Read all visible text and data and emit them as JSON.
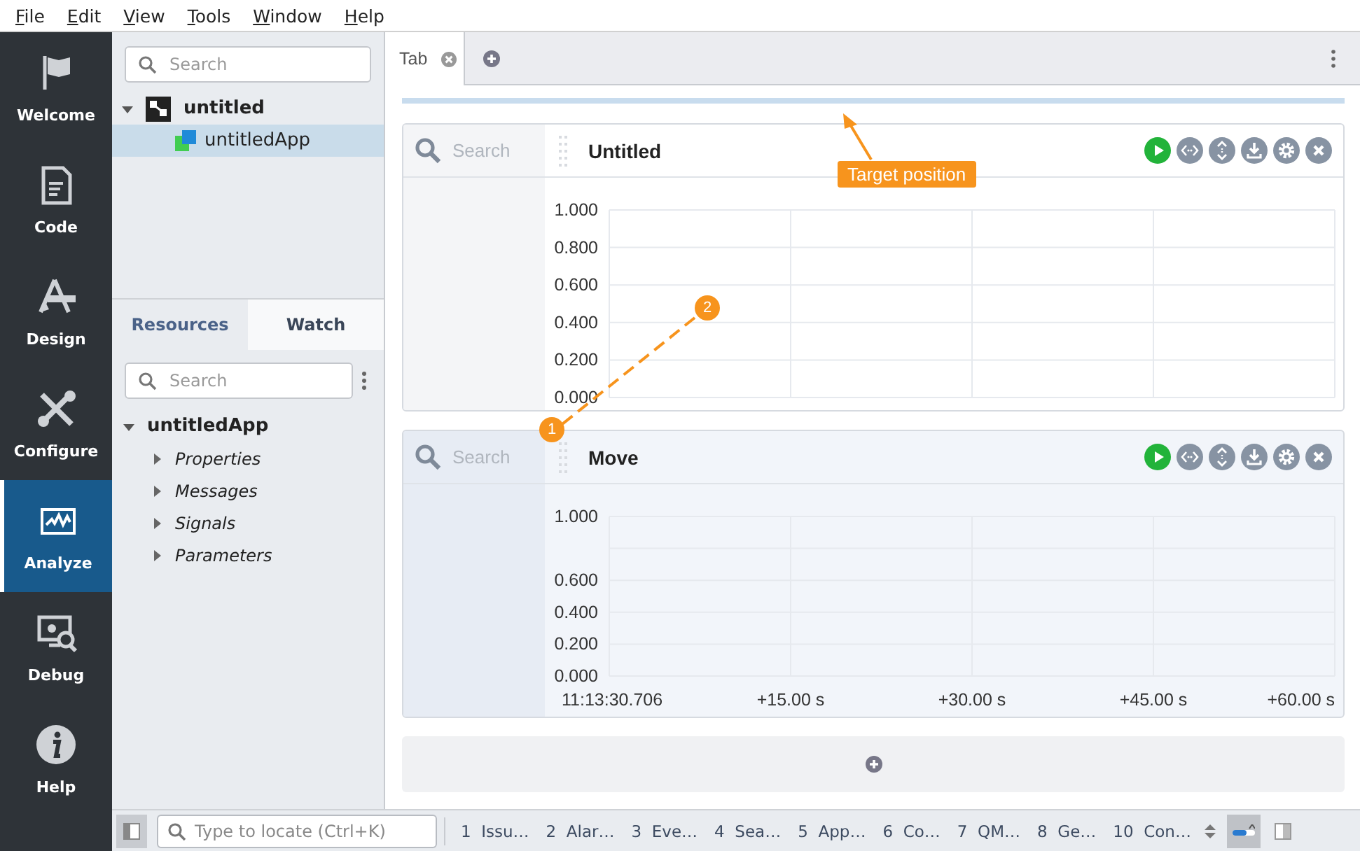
{
  "menu": [
    "File",
    "Edit",
    "View",
    "Tools",
    "Window",
    "Help"
  ],
  "modes": [
    {
      "label": "Welcome",
      "selected": false
    },
    {
      "label": "Code",
      "selected": false
    },
    {
      "label": "Design",
      "selected": false
    },
    {
      "label": "Configure",
      "selected": false
    },
    {
      "label": "Analyze",
      "selected": true
    },
    {
      "label": "Debug",
      "selected": false
    },
    {
      "label": "Help",
      "selected": false
    }
  ],
  "project_tree": {
    "search": {
      "placeholder": "Search"
    },
    "items": [
      {
        "label": "untitled",
        "expanded": true,
        "selected": false,
        "children": [
          {
            "label": "untitledApp",
            "selected": true
          }
        ]
      }
    ]
  },
  "resource_tabs": [
    {
      "label": "Resources",
      "selected": true
    },
    {
      "label": "Watch",
      "selected": false
    }
  ],
  "resource_search": {
    "placeholder": "Search"
  },
  "resource_tree": [
    {
      "label": "untitledApp",
      "expanded": true,
      "children": [
        {
          "label": "Properties",
          "expanded": false
        },
        {
          "label": "Messages",
          "expanded": false
        },
        {
          "label": "Signals",
          "expanded": false
        },
        {
          "label": "Parameters",
          "expanded": false
        }
      ]
    }
  ],
  "document_tabs": [
    {
      "label": "Tab",
      "selected": true
    }
  ],
  "panels": [
    {
      "title": "Untitled",
      "selected": false,
      "search": {
        "placeholder": "Search"
      },
      "chart_data": {
        "type": "line",
        "grid": true,
        "ylim": [
          0,
          1
        ],
        "xlim": [
          0,
          60
        ],
        "yticks": [
          {
            "value": 0,
            "label": "0.000"
          },
          {
            "value": 0.2,
            "label": "0.200"
          },
          {
            "value": 0.4,
            "label": "0.400"
          },
          {
            "value": 0.6,
            "label": "0.600"
          },
          {
            "value": 0.8,
            "label": "0.800"
          },
          {
            "value": 1,
            "label": "1.000"
          }
        ]
      }
    },
    {
      "title": "Move",
      "selected": true,
      "search": {
        "placeholder": "Search"
      },
      "chart_data": {
        "type": "line",
        "grid": true,
        "ylim": [
          0,
          1
        ],
        "xlim": [
          0,
          60
        ],
        "yticks": [
          {
            "value": 0,
            "label": "0.000"
          },
          {
            "value": 0.2,
            "label": "0.200"
          },
          {
            "value": 0.4,
            "label": "0.400"
          },
          {
            "value": 0.6,
            "label": "0.600"
          },
          {
            "value": 1,
            "label": "1.000"
          }
        ],
        "xticks": [
          {
            "value": 0,
            "label": "11:13:30.706"
          },
          {
            "value": 15,
            "label": "+15.00 s"
          },
          {
            "value": 30,
            "label": "+30.00 s"
          },
          {
            "value": 45,
            "label": "+45.00 s"
          },
          {
            "value": 60,
            "label": "+60.00 s"
          }
        ]
      }
    }
  ],
  "annotations": {
    "target_label": "Target position",
    "markers": [
      "2",
      "1"
    ]
  },
  "status_bar": {
    "locator": {
      "placeholder": "Type to locate (Ctrl+K)"
    },
    "panes": [
      {
        "number": "1",
        "label": "Issu…"
      },
      {
        "number": "2",
        "label": "Alar…"
      },
      {
        "number": "3",
        "label": "Eve…"
      },
      {
        "number": "4",
        "label": "Sea…"
      },
      {
        "number": "5",
        "label": "App…"
      },
      {
        "number": "6",
        "label": "Co…"
      },
      {
        "number": "7",
        "label": "QM…"
      },
      {
        "number": "8",
        "label": "Ge…"
      },
      {
        "number": "10",
        "label": "Con…"
      }
    ]
  }
}
